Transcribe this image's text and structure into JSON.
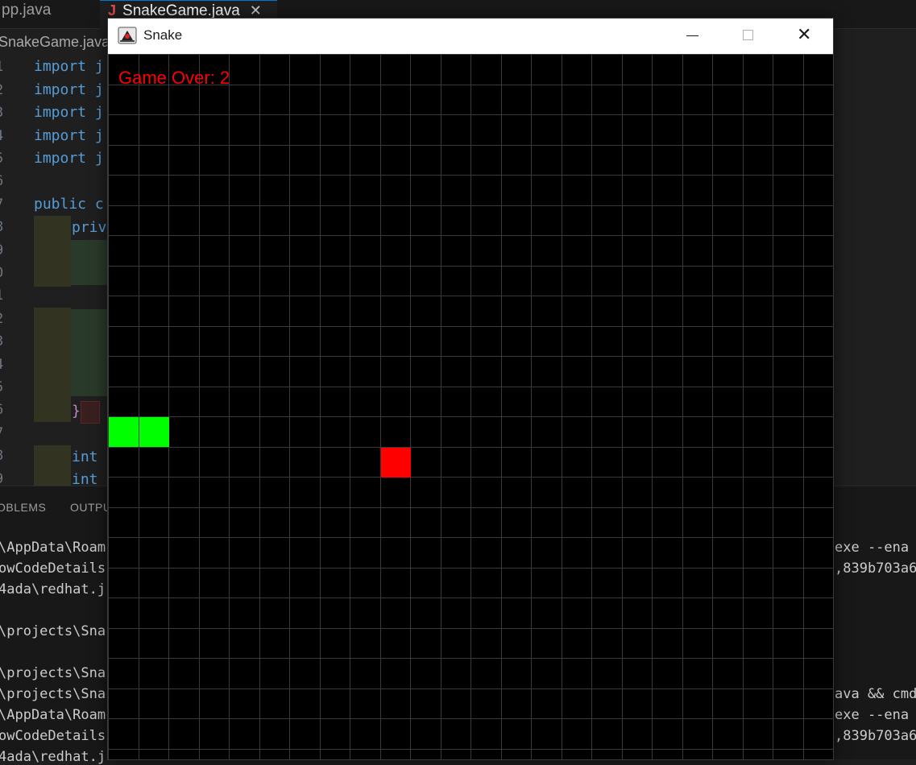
{
  "editor": {
    "tabs": [
      {
        "label": "pp.java",
        "active": false
      },
      {
        "label": "SnakeGame.java",
        "active": true,
        "icon": "java-file-icon"
      }
    ],
    "breadcrumb": "SnakeGame.java",
    "line_numbers": [
      "1",
      "2",
      "3",
      "4",
      "5",
      "6",
      "7",
      "8",
      "9",
      "0",
      "1",
      "2",
      "3",
      "4",
      "5",
      "6",
      "7",
      "8",
      "9"
    ],
    "code_lines": [
      {
        "kind": "kw",
        "text": "import j"
      },
      {
        "kind": "kw",
        "text": "import j"
      },
      {
        "kind": "kw",
        "text": "import j"
      },
      {
        "kind": "kw",
        "text": "import j"
      },
      {
        "kind": "kw",
        "text": "import j"
      },
      {
        "kind": "kw",
        "text": "public c"
      },
      {
        "kind": "kw",
        "text": "priv"
      },
      {
        "kind": "pl",
        "text": "}"
      },
      {
        "kind": "kw",
        "text": "int"
      },
      {
        "kind": "kw",
        "text": "int"
      }
    ]
  },
  "panel": {
    "tabs": [
      "OBLEMS",
      "OUTPU"
    ],
    "terminal_left": [
      "\\AppData\\Roam",
      "owCodeDetails",
      "4ada\\redhat.j",
      "",
      "\\projects\\Sna",
      "",
      "\\projects\\Sna",
      "\\projects\\Sna",
      "\\AppData\\Roam",
      "owCodeDetails",
      "4ada\\redhat.j"
    ],
    "terminal_right": [
      "exe --ena",
      ",839b703a6",
      "",
      "",
      "",
      "",
      "",
      "ava && cmd",
      "exe --ena",
      ",839b703a6",
      ""
    ]
  },
  "window": {
    "title": "Snake",
    "icon": "java-duke-icon",
    "controls": {
      "minimize": "minimize-icon",
      "maximize": "maximize-icon",
      "close": "close-icon"
    }
  },
  "game": {
    "status_text": "Game Over: 2",
    "status_color": "#ff0000",
    "grid": {
      "columns": 24,
      "rows": 24
    },
    "snake_color": "#00ff00",
    "food_color": "#ff0000",
    "snake": [
      [
        0,
        12
      ],
      [
        1,
        12
      ]
    ],
    "food": [
      9,
      13
    ]
  },
  "colors": {
    "board_bg": "#000000",
    "grid_line": "#3a3a3a"
  }
}
